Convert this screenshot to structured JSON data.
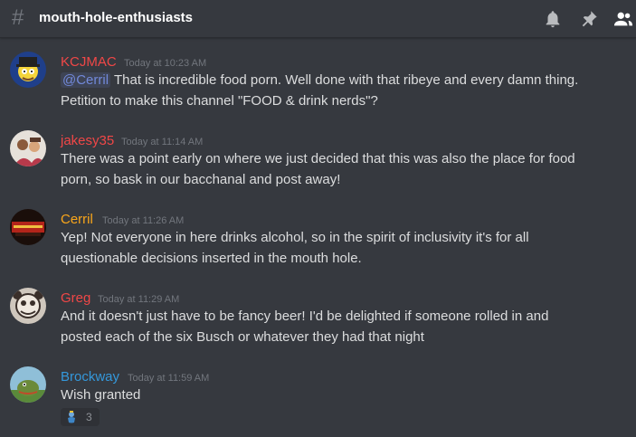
{
  "channel": {
    "name": "mouth-hole-enthusiasts",
    "icons": [
      "hash-icon",
      "bell-icon",
      "pin-icon",
      "members-icon"
    ]
  },
  "colors": {
    "background": "#36393f",
    "text": "#dcddde",
    "timestamp": "#72767d",
    "mention": "#7289da"
  },
  "messages": [
    {
      "author": "KCJMAC",
      "author_color": "#f04747",
      "timestamp": "Today at 10:23 AM",
      "mention": "@Cerril",
      "line1": "That is incredible food porn. Well done with that ribeye and every damn thing.",
      "line2": "Petition to make this channel \"FOOD & drink nerds\"?"
    },
    {
      "author": "jakesy35",
      "author_color": "#f04747",
      "timestamp": "Today at 11:14 AM",
      "line1": "There was a point early on where we just decided that this was also the place for food",
      "line2": "porn, so bask in our bacchanal and post away!"
    },
    {
      "author": "Cerril",
      "author_color": "#faa61a",
      "timestamp": "Today at 11:26 AM",
      "line1": "Yep! Not everyone in here drinks alcohol, so in the spirit of inclusivity it's for all",
      "line2": "questionable decisions inserted in the mouth hole."
    },
    {
      "author": "Greg",
      "author_color": "#f04747",
      "timestamp": "Today at 11:29 AM",
      "line1": "And it doesn't just have to be fancy beer!  I'd be delighted if someone rolled in and",
      "line2": "posted each of the six Busch or whatever they had that night"
    },
    {
      "author": "Brockway",
      "author_color": "#3498db",
      "timestamp": "Today at 11:59 AM",
      "line1": "Wish granted",
      "reaction": {
        "emoji": "genie-emoji",
        "count": "3"
      }
    }
  ]
}
